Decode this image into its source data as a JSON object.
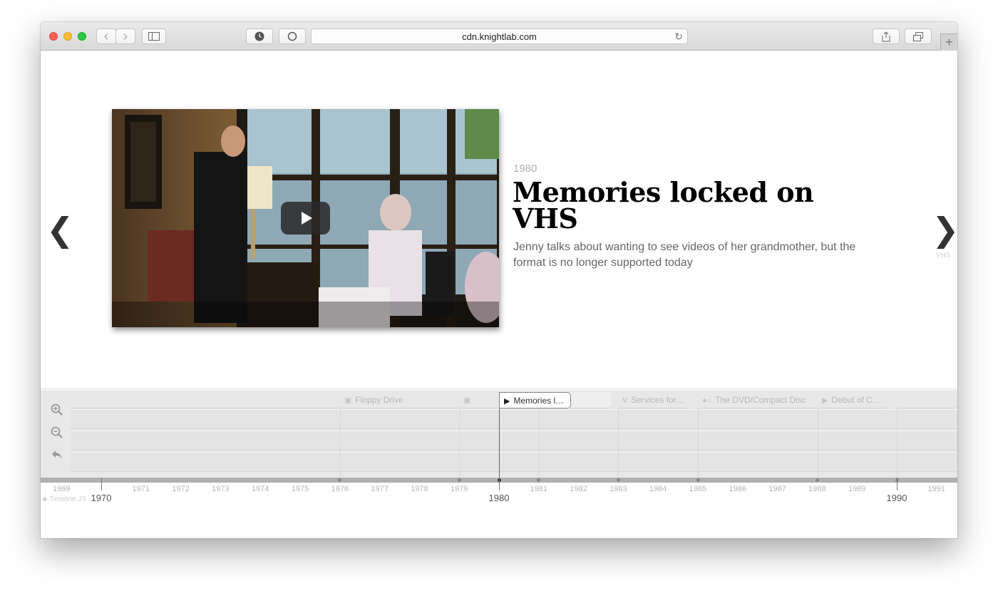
{
  "browser": {
    "url": "cdn.knightlab.com",
    "back_glyph": "‹",
    "forward_glyph": "›",
    "new_tab_glyph": "+"
  },
  "slide": {
    "date": "1980",
    "title": "Memories locked on VHS",
    "text": "Jenny talks about wanting to see videos of her grandmother, but the format is no longer supported today",
    "prev_glyph": "❮",
    "next_glyph": "❯",
    "next_label": "VHS",
    "media_type": "youtube-video"
  },
  "timeline": {
    "brand": "Timeline JS",
    "markers": [
      {
        "label": "",
        "icon": "image-icon"
      },
      {
        "label": "Floppy Drive",
        "icon": "image-icon"
      },
      {
        "label": "",
        "icon": "image-icon"
      },
      {
        "label": "Memories l…",
        "icon": "youtube-icon",
        "active": true
      },
      {
        "label": "",
        "icon": ""
      },
      {
        "label": "Services for…",
        "icon": "vimeo-icon"
      },
      {
        "label": "The DVD/Compact Disc",
        "icon": "flickr-icon"
      },
      {
        "label": "Debut of C…",
        "icon": "youtube-icon"
      },
      {
        "label": "",
        "icon": ""
      }
    ],
    "minor_years": [
      "1969",
      "1971",
      "1972",
      "1973",
      "1974",
      "1975",
      "1976",
      "1977",
      "1978",
      "1979",
      "1981",
      "1982",
      "1983",
      "1984",
      "1985",
      "1986",
      "1987",
      "1988",
      "1989",
      "1991"
    ],
    "major_years": [
      "1970",
      "1980",
      "1990"
    ],
    "active_year": "1980"
  }
}
